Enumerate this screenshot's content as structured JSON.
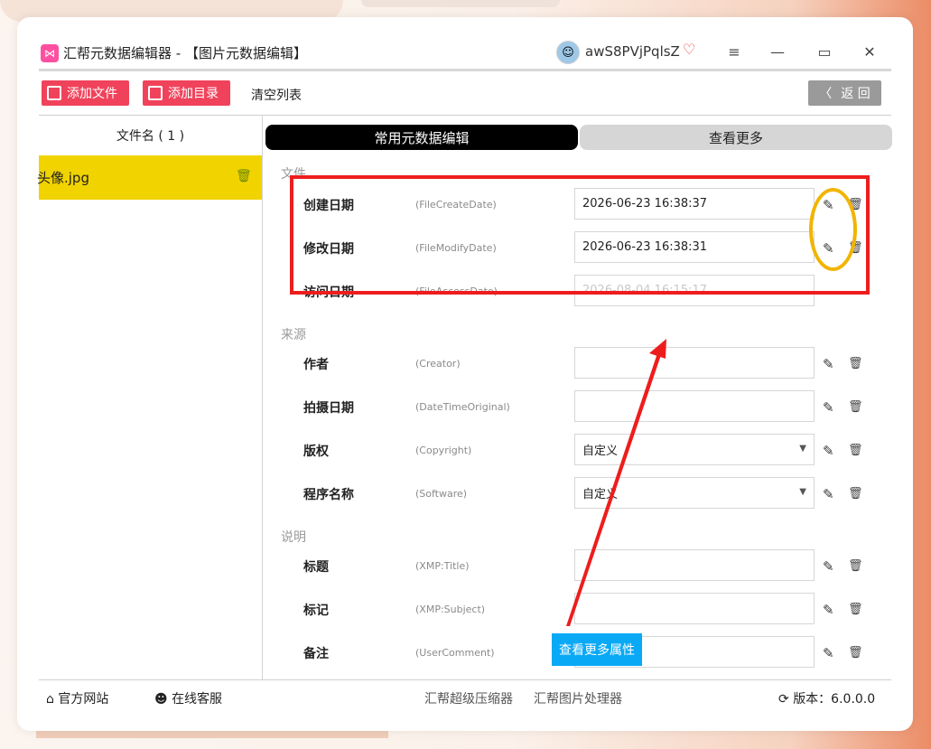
{
  "app": {
    "title": "汇帮元数据编辑器 - 【图片元数据编辑】",
    "username": "awS8PVjPqlsZ",
    "window_controls": [
      "menu-icon",
      "minimize-icon",
      "maximize-icon",
      "close-icon"
    ]
  },
  "toolbar": {
    "add_file": "添加文件",
    "add_folder": "添加目录",
    "clear_list": "清空列表",
    "back": "返 回"
  },
  "file_list": {
    "header": "文件名 ( 1 )",
    "items": [
      {
        "name": "头像.jpg"
      }
    ]
  },
  "tabs": {
    "common": "常用元数据编辑",
    "more": "查看更多"
  },
  "sections": {
    "file": "文件",
    "source": "来源",
    "description": "说明"
  },
  "fields": {
    "create_date": {
      "label": "创建日期",
      "key": "(FileCreateDate)",
      "value": "2026-06-23 16:38:37"
    },
    "modify_date": {
      "label": "修改日期",
      "key": "(FileModifyDate)",
      "value": "2026-06-23 16:38:31"
    },
    "access_date": {
      "label": "访问日期",
      "key": "(FileAccessDate)",
      "value": "2026-08-04 16:15:17"
    },
    "creator": {
      "label": "作者",
      "key": "(Creator)",
      "value": ""
    },
    "date_original": {
      "label": "拍摄日期",
      "key": "(DateTimeOriginal)",
      "value": ""
    },
    "copyright": {
      "label": "版权",
      "key": "(Copyright)",
      "value": "自定义"
    },
    "software": {
      "label": "程序名称",
      "key": "(Software)",
      "value": "自定义"
    },
    "title": {
      "label": "标题",
      "key": "(XMP:Title)",
      "value": ""
    },
    "subject": {
      "label": "标记",
      "key": "(XMP:Subject)",
      "value": ""
    },
    "comment": {
      "label": "备注",
      "key": "(UserComment)",
      "value": ""
    }
  },
  "annotation": {
    "callout": "查看更多属性",
    "highlight_color": "#ee1d1d",
    "circle_color": "#f2b400"
  },
  "footer": {
    "website": "官方网站",
    "support": "在线客服",
    "compressor": "汇帮超级压缩器",
    "image_tool": "汇帮图片处理器",
    "version": "版本：6.0.0.0"
  },
  "colors": {
    "accent": "#f0435b",
    "selected_row": "#f1d300",
    "callout": "#0aa9f5"
  }
}
